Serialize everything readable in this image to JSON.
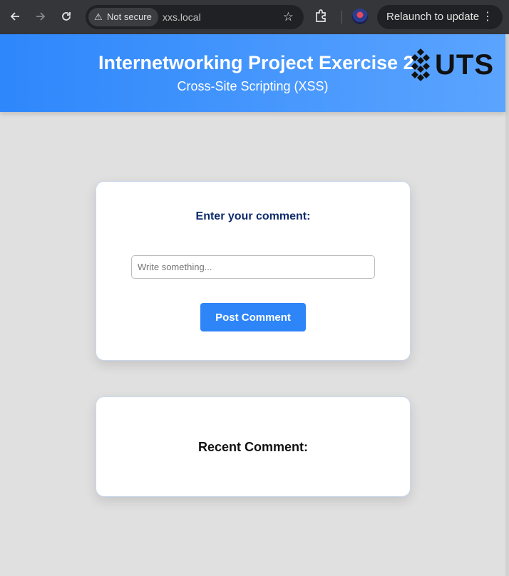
{
  "browser": {
    "back_icon": "arrow-left-icon",
    "forward_icon": "arrow-right-icon",
    "reload_icon": "reload-icon",
    "security_label": "Not secure",
    "url": "xxs.local",
    "relaunch_label": "Relaunch to update"
  },
  "header": {
    "title": "Internetworking Project Exercise 2",
    "subtitle": "Cross-Site Scripting (XSS)",
    "logo_text": "UTS",
    "gradient_start": "#2e87fb",
    "gradient_end": "#5ba4ff"
  },
  "form": {
    "heading": "Enter your comment:",
    "input_placeholder": "Write something...",
    "input_value": "",
    "submit_label": "Post Comment",
    "accent_color": "#2e85f8"
  },
  "comments": {
    "heading": "Recent Comment:"
  }
}
